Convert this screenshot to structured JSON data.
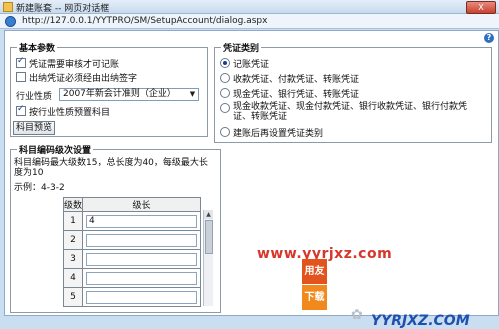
{
  "window": {
    "title": "新建账套 -- 网页对话框",
    "close_label": "X",
    "url": "http://127.0.0.1/YYTPRO/SM/SetupAccount/dialog.aspx"
  },
  "help_label": "?",
  "basic_params": {
    "legend": "基本参数",
    "options": [
      {
        "label": "凭证需要审核才可记账",
        "checked": true
      },
      {
        "label": "出纳凭证必须经由出纳签字",
        "checked": false
      }
    ],
    "industry_label": "行业性质",
    "industry_value": "2007年新会计准则（企业）",
    "preset_accounts": {
      "label": "按行业性质预置科目",
      "checked": true
    },
    "preview_button": "科目预览"
  },
  "voucher_types": {
    "legend": "凭证类别",
    "options": [
      {
        "label": "记账凭证",
        "selected": true
      },
      {
        "label": "收款凭证、付款凭证、转账凭证",
        "selected": false
      },
      {
        "label": "现金凭证、银行凭证、转账凭证",
        "selected": false
      },
      {
        "label": "现金收款凭证、现金付款凭证、银行收款凭证、银行付款凭证、转账凭证",
        "selected": false
      },
      {
        "label": "建账后再设置凭证类别",
        "selected": false
      }
    ]
  },
  "code_levels": {
    "legend": "科目编码级次设置",
    "desc": "科目编码最大级数15，总长度为40，每级最大长度为10",
    "example": "示例：4-3-2",
    "col_level": "级数",
    "col_length": "级长",
    "rows": [
      {
        "level": "1",
        "length": "4"
      },
      {
        "level": "2",
        "length": ""
      },
      {
        "level": "3",
        "length": ""
      },
      {
        "level": "4",
        "length": ""
      },
      {
        "level": "5",
        "length": ""
      }
    ]
  },
  "watermark": {
    "site": "www.yyrjxz.com",
    "logo_char_1": "用友",
    "logo_char_2": "下载",
    "brand": "YYRJXZ.COM"
  }
}
